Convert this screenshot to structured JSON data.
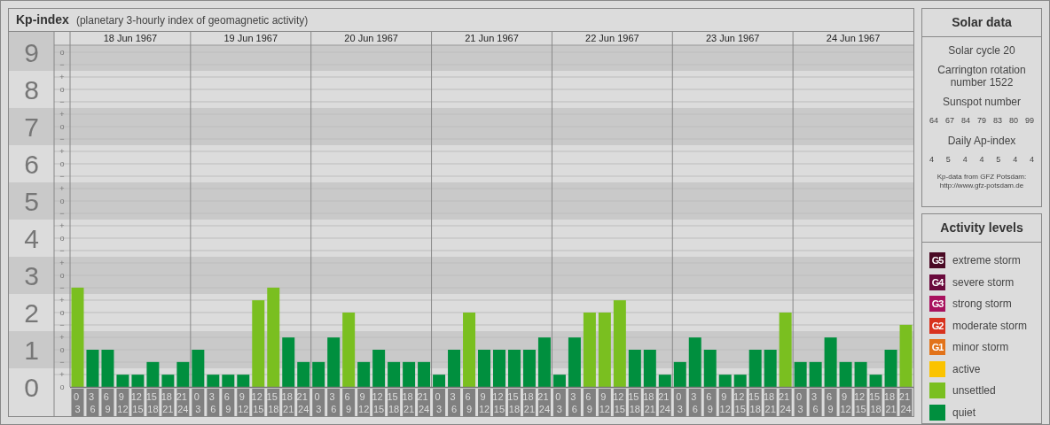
{
  "header": {
    "title": "Kp-index",
    "subtitle": "(planetary 3-hourly index of geomagnetic activity)"
  },
  "chart": {
    "days": [
      {
        "date": "18 Jun 1967"
      },
      {
        "date": "19 Jun 1967"
      },
      {
        "date": "20 Jun 1967"
      },
      {
        "date": "21 Jun 1967"
      },
      {
        "date": "22 Jun 1967"
      },
      {
        "date": "23 Jun 1967"
      },
      {
        "date": "24 Jun 1967"
      }
    ],
    "chart_data": {
      "type": "bar",
      "ylim": [
        0,
        9.19
      ],
      "grid": true,
      "bands": [
        {
          "axis": "y",
          "from": 8.5,
          "to": 9.19
        },
        {
          "axis": "y",
          "from": 6.5,
          "to": 7.5
        },
        {
          "axis": "y",
          "from": 4.5,
          "to": 5.5
        },
        {
          "axis": "y",
          "from": 2.5,
          "to": 3.5
        },
        {
          "axis": "y",
          "from": 0.5,
          "to": 1.5
        }
      ],
      "categories": [
        "0 3",
        "3 6",
        "6 9",
        "9 12",
        "12 15",
        "15 18",
        "18 21",
        "21 24",
        "0 3",
        "3 6",
        "6 9",
        "9 12",
        "12 15",
        "15 18",
        "18 21",
        "21 24",
        "0 3",
        "3 6",
        "6 9",
        "9 12",
        "12 15",
        "15 18",
        "18 21",
        "21 24",
        "0 3",
        "3 6",
        "6 9",
        "9 12",
        "12 15",
        "15 18",
        "18 21",
        "21 24",
        "0 3",
        "3 6",
        "6 9",
        "9 12",
        "12 15",
        "15 18",
        "18 21",
        "21 24",
        "0 3",
        "3 6",
        "6 9",
        "9 12",
        "12 15",
        "15 18",
        "18 21",
        "21 24",
        "0 3",
        "3 6",
        "6 9",
        "9 12",
        "12 15",
        "15 18",
        "18 21",
        "21 24"
      ],
      "values": [
        2.67,
        1,
        1,
        0.33,
        0.33,
        0.67,
        0.33,
        0.67,
        1,
        0.33,
        0.33,
        0.33,
        2.33,
        2.67,
        1.33,
        0.67,
        0.67,
        1.33,
        2,
        0.67,
        1,
        0.67,
        0.67,
        0.67,
        0.33,
        1,
        2,
        1,
        1,
        1,
        1,
        1.33,
        0.33,
        1.33,
        2,
        2,
        2.33,
        1,
        1,
        0.33,
        0.67,
        1.33,
        1,
        0.33,
        0.33,
        1,
        1,
        2,
        0.67,
        0.67,
        1.33,
        0.67,
        0.67,
        0.33,
        1,
        1.67
      ],
      "yticks": [
        {
          "value": 9,
          "label": "9"
        },
        {
          "value": 8,
          "label": "8"
        },
        {
          "value": 7,
          "label": "7"
        },
        {
          "value": 6,
          "label": "6"
        },
        {
          "value": 5,
          "label": "5"
        },
        {
          "value": 4,
          "label": "4"
        },
        {
          "value": 3,
          "label": "3"
        },
        {
          "value": 2,
          "label": "2"
        },
        {
          "value": 1,
          "label": "1"
        },
        {
          "value": 0,
          "label": "0"
        }
      ]
    },
    "scale_marks": [
      "o",
      "−",
      "+",
      "o",
      "−",
      "+",
      "o",
      "−",
      "+",
      "o",
      "−",
      "+",
      "o",
      "−",
      "+",
      "o",
      "−",
      "+",
      "o",
      "−",
      "+",
      "o",
      "−",
      "+",
      "o",
      "−",
      "+",
      "o"
    ]
  },
  "solar_data": {
    "title": "Solar data",
    "cycle": "Solar cycle 20",
    "carrington": "Carrington rotation number 1522",
    "sunspot_label": "Sunspot number",
    "sunspot_numbers": [
      "64",
      "67",
      "84",
      "79",
      "83",
      "80",
      "99"
    ],
    "ap_label": "Daily Ap-index",
    "ap_values": [
      "4",
      "5",
      "4",
      "4",
      "5",
      "4",
      "4"
    ],
    "source_note": "Kp-data from GFZ Potsdam:",
    "source_url": "http://www.gfz-potsdam.de"
  },
  "activity_levels": {
    "title": "Activity levels",
    "items": [
      {
        "badge": "G5",
        "label": "extreme storm",
        "color": "#4a0a24"
      },
      {
        "badge": "G4",
        "label": "severe storm",
        "color": "#6a0a3c"
      },
      {
        "badge": "G3",
        "label": "strong storm",
        "color": "#a8125e"
      },
      {
        "badge": "G2",
        "label": "moderate storm",
        "color": "#d8321e"
      },
      {
        "badge": "G1",
        "label": "minor storm",
        "color": "#e2731a"
      },
      {
        "label": "active",
        "color": "#fbc300"
      },
      {
        "label": "unsettled",
        "color": "#7abf20"
      },
      {
        "label": "quiet",
        "color": "#008f3e"
      }
    ]
  }
}
